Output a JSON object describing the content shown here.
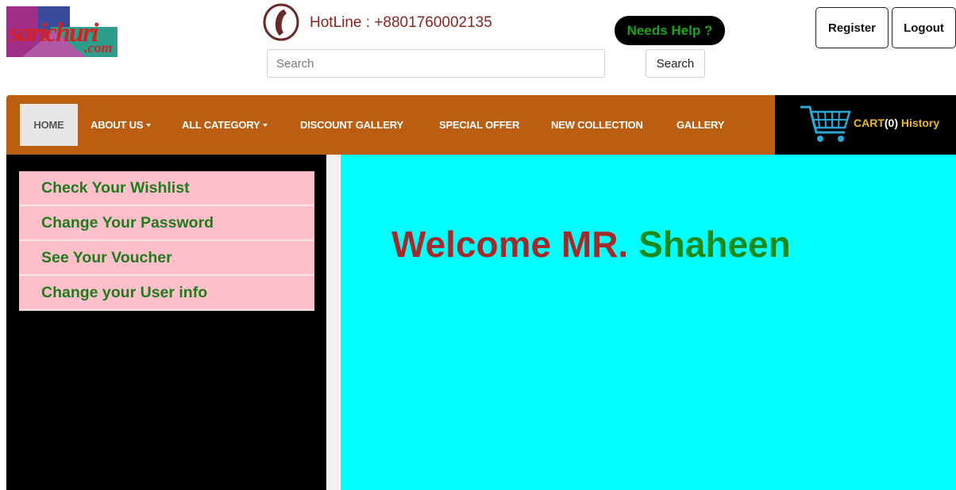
{
  "header": {
    "logo_text": "sarichuri.com",
    "hotline": "HotLine : +8801760002135",
    "needs_help": "Needs Help ?",
    "search_placeholder": "Search",
    "search_button": "Search",
    "register_button": "Register",
    "logout_button": "Logout"
  },
  "nav": {
    "items": [
      {
        "label": "HOME",
        "has_dropdown": false,
        "active": true
      },
      {
        "label": "ABOUT US",
        "has_dropdown": true
      },
      {
        "label": "ALL CATEGORY",
        "has_dropdown": true
      },
      {
        "label": "DISCOUNT GALLERY",
        "has_dropdown": false
      },
      {
        "label": "SPECIAL OFFER",
        "has_dropdown": false
      },
      {
        "label": "NEW COLLECTION",
        "has_dropdown": false
      },
      {
        "label": "GALLERY",
        "has_dropdown": false
      }
    ],
    "cart": {
      "label": "CART",
      "count": "(0)",
      "history": "History"
    }
  },
  "sidebar": {
    "items": [
      {
        "label": "Check Your Wishlist"
      },
      {
        "label": "Change Your Password"
      },
      {
        "label": "See Your Voucher"
      },
      {
        "label": "Change your User info"
      }
    ]
  },
  "main": {
    "welcome_prefix": "Welcome MR.",
    "welcome_name": "Shaheen"
  },
  "colors": {
    "navbar": "#bc5e12",
    "sidebar_item_bg": "#ffc0cb",
    "sidebar_text": "#207a1e",
    "main_bg": "#00ffff",
    "welcome_prefix": "#a52a2a",
    "welcome_name": "#1a8a1a"
  },
  "icons": [
    "logo-icon",
    "phone-icon",
    "caret-down-icon",
    "cart-icon"
  ]
}
